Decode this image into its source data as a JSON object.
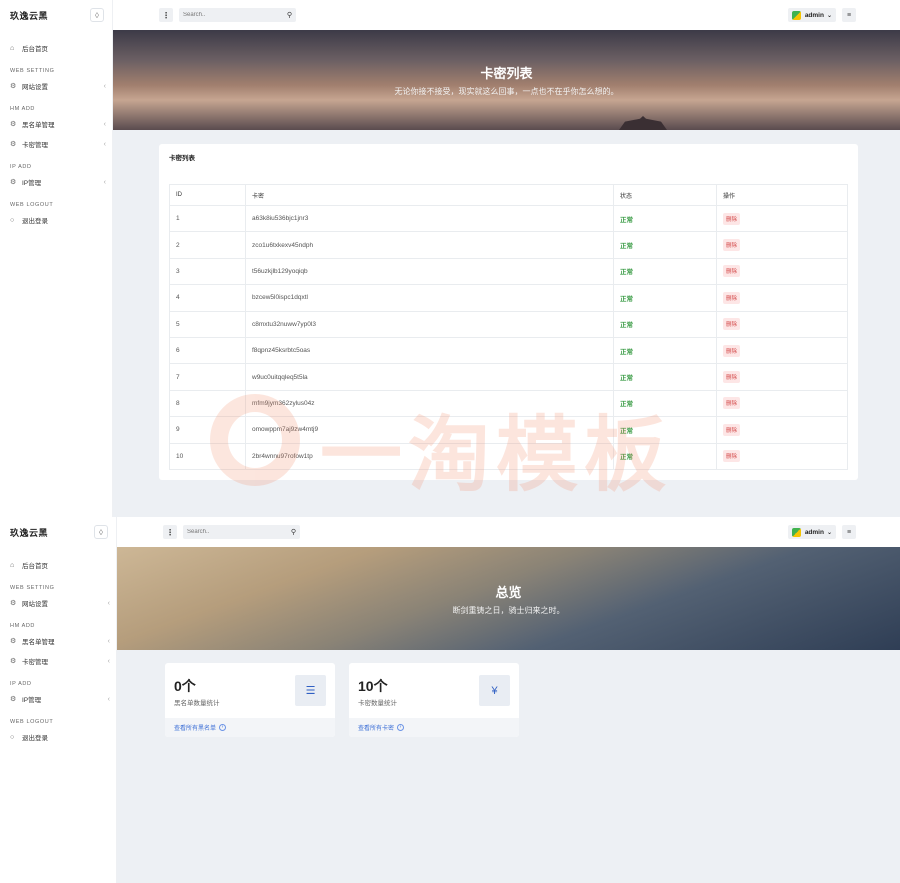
{
  "shot1": {
    "brand": "玖逸云黑",
    "search_placeholder": "Search..",
    "user": "admin",
    "nav": {
      "home": "后台首页",
      "cat_web": "WEB SETTING",
      "site": "网站设置",
      "cat_hm": "HM ADD",
      "blacklist": "黑名单管理",
      "cards": "卡密管理",
      "cat_ip": "IP ADD",
      "ip": "IP管理",
      "cat_logout": "WEB LOGOUT",
      "logout": "退出登录"
    },
    "hero": {
      "title": "卡密列表",
      "subtitle": "无论你接不接受，现实就这么回事，一点也不在乎你怎么想的。"
    },
    "card_title": "卡密列表",
    "table": {
      "headers": [
        "ID",
        "卡密",
        "状态",
        "操作"
      ],
      "rows": [
        {
          "id": "1",
          "code": "a63k8iu536bjc1jnr3",
          "status": "正常",
          "action": "删除"
        },
        {
          "id": "2",
          "code": "zco1u6txkexv45ndph",
          "status": "正常",
          "action": "删除"
        },
        {
          "id": "3",
          "code": "t56uzkjlb129yoqiqb",
          "status": "正常",
          "action": "删除"
        },
        {
          "id": "4",
          "code": "bzcew5l0ispc1dqxtl",
          "status": "正常",
          "action": "删除"
        },
        {
          "id": "5",
          "code": "c8mxtu32nuww7yp0l3",
          "status": "正常",
          "action": "删除"
        },
        {
          "id": "6",
          "code": "f8qpnz45ksrbtc5oas",
          "status": "正常",
          "action": "删除"
        },
        {
          "id": "7",
          "code": "w9uc0uitqqleq5t5la",
          "status": "正常",
          "action": "删除"
        },
        {
          "id": "8",
          "code": "mfm9jym362zylus04z",
          "status": "正常",
          "action": "删除"
        },
        {
          "id": "9",
          "code": "omowppm7aj9zw4mtj9",
          "status": "正常",
          "action": "删除"
        },
        {
          "id": "10",
          "code": "2br4wnnu97rofow1tp",
          "status": "正常",
          "action": "删除"
        }
      ]
    },
    "watermark": "一淘模板"
  },
  "shot2": {
    "brand": "玖逸云黑",
    "search_placeholder": "Search..",
    "user": "admin",
    "nav": {
      "home": "后台首页",
      "cat_web": "WEB SETTING",
      "site": "网站设置",
      "cat_hm": "HM ADD",
      "blacklist": "黑名单管理",
      "cards": "卡密管理",
      "cat_ip": "IP ADD",
      "ip": "IP管理",
      "cat_logout": "WEB LOGOUT",
      "logout": "退出登录"
    },
    "hero": {
      "title": "总览",
      "subtitle": "断剑重铸之日，骑士归来之时。"
    },
    "stats": [
      {
        "value": "0个",
        "label": "黑名单数量统计",
        "link": "查看所有黑名单",
        "icon": "list-icon",
        "glyph": "☰"
      },
      {
        "value": "10个",
        "label": "卡密数量统计",
        "link": "查看所有卡密",
        "icon": "yen-icon",
        "glyph": "¥"
      }
    ]
  },
  "colors": {
    "accent": "#3d6fd6",
    "ok": "#3b9c46",
    "danger": "#d34a4a",
    "background": "#edf0f4"
  }
}
